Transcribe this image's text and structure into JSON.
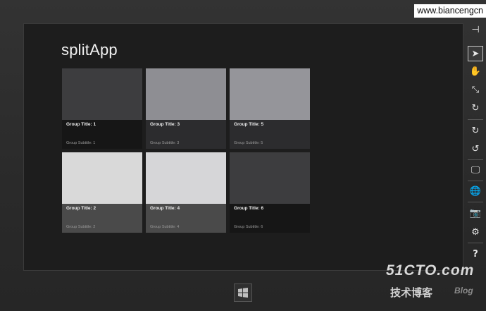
{
  "watermark": "www.biancengcn",
  "app": {
    "title": "splitApp"
  },
  "groups": [
    {
      "title": "Group Title: 1",
      "subtitle": "Group Subtitle: 1",
      "image_color": "#3d3d3f",
      "caption_color": "#161616"
    },
    {
      "title": "Group Title: 3",
      "subtitle": "Group Subtitle: 3",
      "image_color": "#8e8e93",
      "caption_color": "#2c2c2e"
    },
    {
      "title": "Group Title: 5",
      "subtitle": "Group Subtitle: 5",
      "image_color": "#95959a",
      "caption_color": "#2c2c2e"
    },
    {
      "title": "Group Title: 2",
      "subtitle": "Group Subtitle: 2",
      "image_color": "#d9d9d9",
      "caption_color": "#4a4a4a"
    },
    {
      "title": "Group Title: 4",
      "subtitle": "Group Subtitle: 4",
      "image_color": "#d6d6d8",
      "caption_color": "#4a4a4a"
    },
    {
      "title": "Group Title: 6",
      "subtitle": "Group Subtitle: 6",
      "image_color": "#3d3d3f",
      "caption_color": "#161616"
    }
  ],
  "toolbar": {
    "items": [
      {
        "icon": "pin-icon",
        "glyph": "⊣"
      },
      {
        "icon": "pointer-icon",
        "glyph": "➤",
        "active": true
      },
      {
        "icon": "touch-hand-icon",
        "glyph": "✋"
      },
      {
        "icon": "pinch-zoom-icon",
        "glyph": "⤡"
      },
      {
        "icon": "rotate-gesture-icon",
        "glyph": "↻"
      },
      {
        "icon": "rotate-clockwise-icon",
        "glyph": "↻"
      },
      {
        "icon": "rotate-counterclockwise-icon",
        "glyph": "↺"
      },
      {
        "icon": "resolution-icon",
        "glyph": "🖵"
      },
      {
        "icon": "location-icon",
        "glyph": "🌐"
      },
      {
        "icon": "screenshot-icon",
        "glyph": "📷"
      },
      {
        "icon": "settings-icon",
        "glyph": "⚙"
      },
      {
        "icon": "help-icon",
        "glyph": "?"
      }
    ]
  },
  "watermark_logo": {
    "big": "51CTO.com",
    "cn": "技术博客",
    "blog": "Blog"
  }
}
